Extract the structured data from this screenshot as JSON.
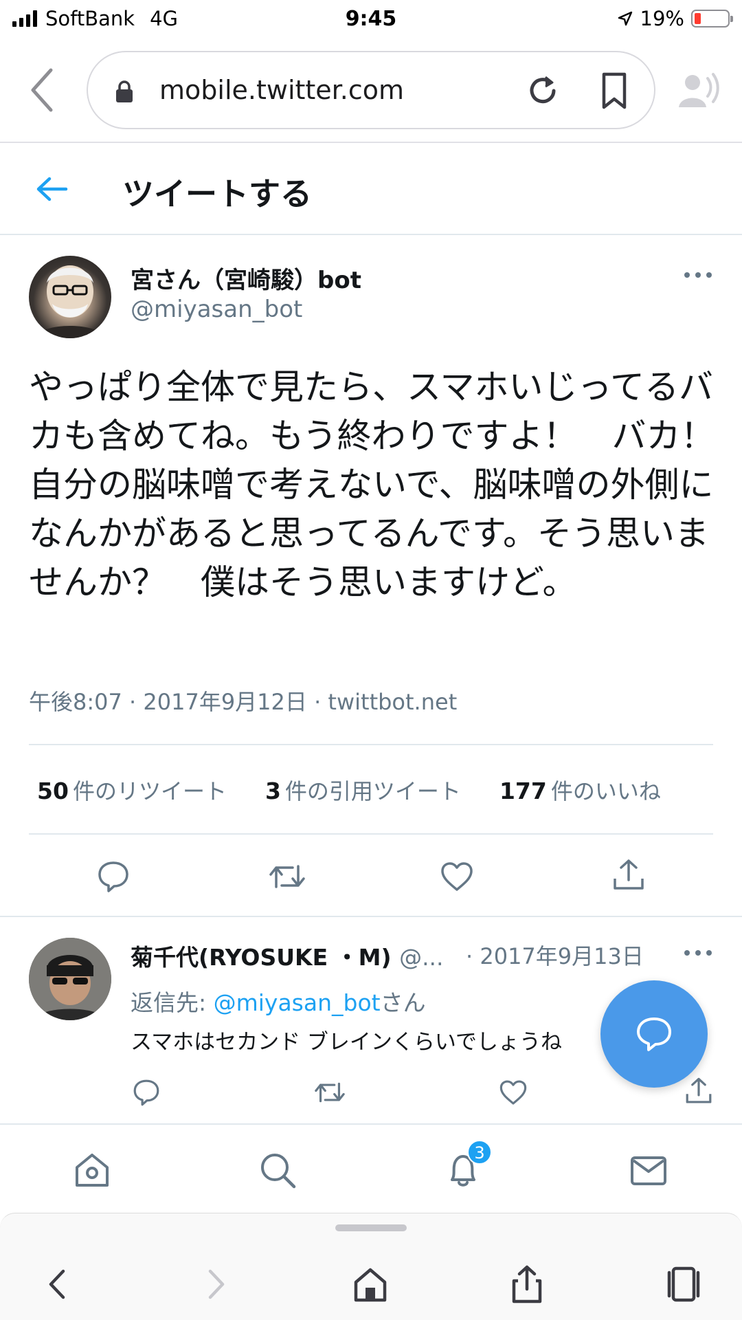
{
  "status_bar": {
    "carrier": "SoftBank",
    "network": "4G",
    "time": "9:45",
    "battery": "19%",
    "battery_level": 0.19
  },
  "browser": {
    "url": "mobile.twitter.com"
  },
  "header": {
    "title": "ツイートする"
  },
  "tweet": {
    "author_name": "宮さん（宮崎駿）bot",
    "author_handle": "@miyasan_bot",
    "text": "やっぱり全体で見たら、スマホいじってるバカも含めてね。もう終わりですよ！　バカ！　自分の脳味噌で考えないで、脳味噌の外側になんかがあると思ってるんです。そう思いませんか？　僕はそう思いますけど。",
    "meta": "午後8:07 · 2017年9月12日 · twittbot.net",
    "stats": [
      {
        "count": "50",
        "label": "件のリツイート"
      },
      {
        "count": "3",
        "label": "件の引用ツイート"
      },
      {
        "count": "177",
        "label": "件のいいね"
      }
    ]
  },
  "reply": {
    "author_name": "菊千代(RYOSUKE ・M)",
    "author_handle": "@...",
    "date": "· 2017年9月13日",
    "reply_prefix": "返信先: ",
    "reply_link": "@miyasan_bot",
    "reply_suffix": "さん",
    "text": "スマホはセカンド ブレインくらいでしょうね"
  },
  "nav": {
    "notification_count": "3"
  },
  "colors": {
    "accent": "#1da1f2",
    "fab": "#4a99e9",
    "secondary_text": "#657786"
  }
}
